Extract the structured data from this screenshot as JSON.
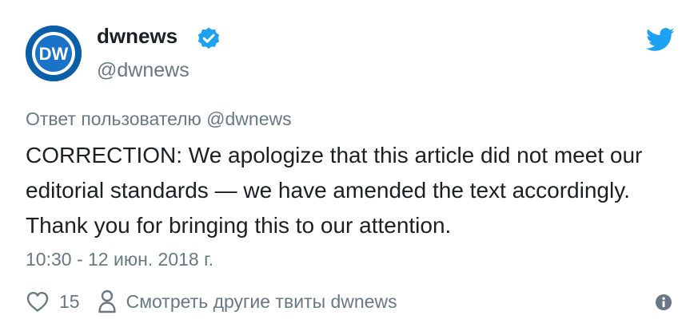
{
  "author": {
    "name": "dwnews",
    "handle": "@dwnews",
    "avatar_text": "DW",
    "verified": true
  },
  "reply_to": {
    "prefix": "Ответ пользователю ",
    "mention": "@dwnews"
  },
  "tweet": {
    "text": "CORRECTION: We apologize that this article did not meet our editorial standards — we have amended the text accordingly. Thank you for bringing this to our attention.",
    "timestamp": "10:30 - 12 июн. 2018 г."
  },
  "actions": {
    "like_count": "15",
    "more_tweets_label": "Смотреть другие твиты dwnews"
  },
  "icons": {
    "logo": "twitter-bird-icon",
    "verified": "verified-badge-icon",
    "like": "heart-icon",
    "more": "person-icon",
    "info": "info-icon"
  },
  "colors": {
    "twitter_blue": "#1da1f2",
    "dw_blue": "#0b5ea8",
    "text_primary": "#1c2022",
    "text_secondary": "#697882"
  }
}
